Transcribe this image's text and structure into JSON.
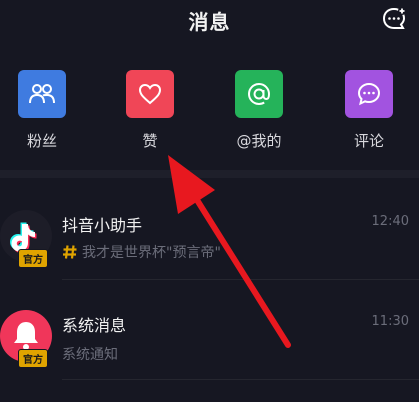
{
  "header": {
    "title": "消息"
  },
  "quick_actions": [
    {
      "label": "粉丝",
      "color": "#3f7be0",
      "icon": "fans-icon"
    },
    {
      "label": "赞",
      "color": "#f04657",
      "icon": "heart-icon"
    },
    {
      "label": "@我的",
      "color": "#25b35a",
      "icon": "at-icon"
    },
    {
      "label": "评论",
      "color": "#a253e0",
      "icon": "comment-icon"
    }
  ],
  "messages": [
    {
      "title": "抖音小助手",
      "subtitle": "我才是世界杯\"预言帝\"",
      "time": "12:40",
      "badge": "官方",
      "avatar_color": "#1d1d28",
      "icon": "tiktok-logo-icon"
    },
    {
      "title": "系统消息",
      "subtitle": "系统通知",
      "time": "11:30",
      "badge": "官方",
      "avatar_color": "#f0365a",
      "icon": "bell-icon"
    }
  ],
  "colors": {
    "background": "#161722",
    "accent_arrow": "#e8181f"
  }
}
